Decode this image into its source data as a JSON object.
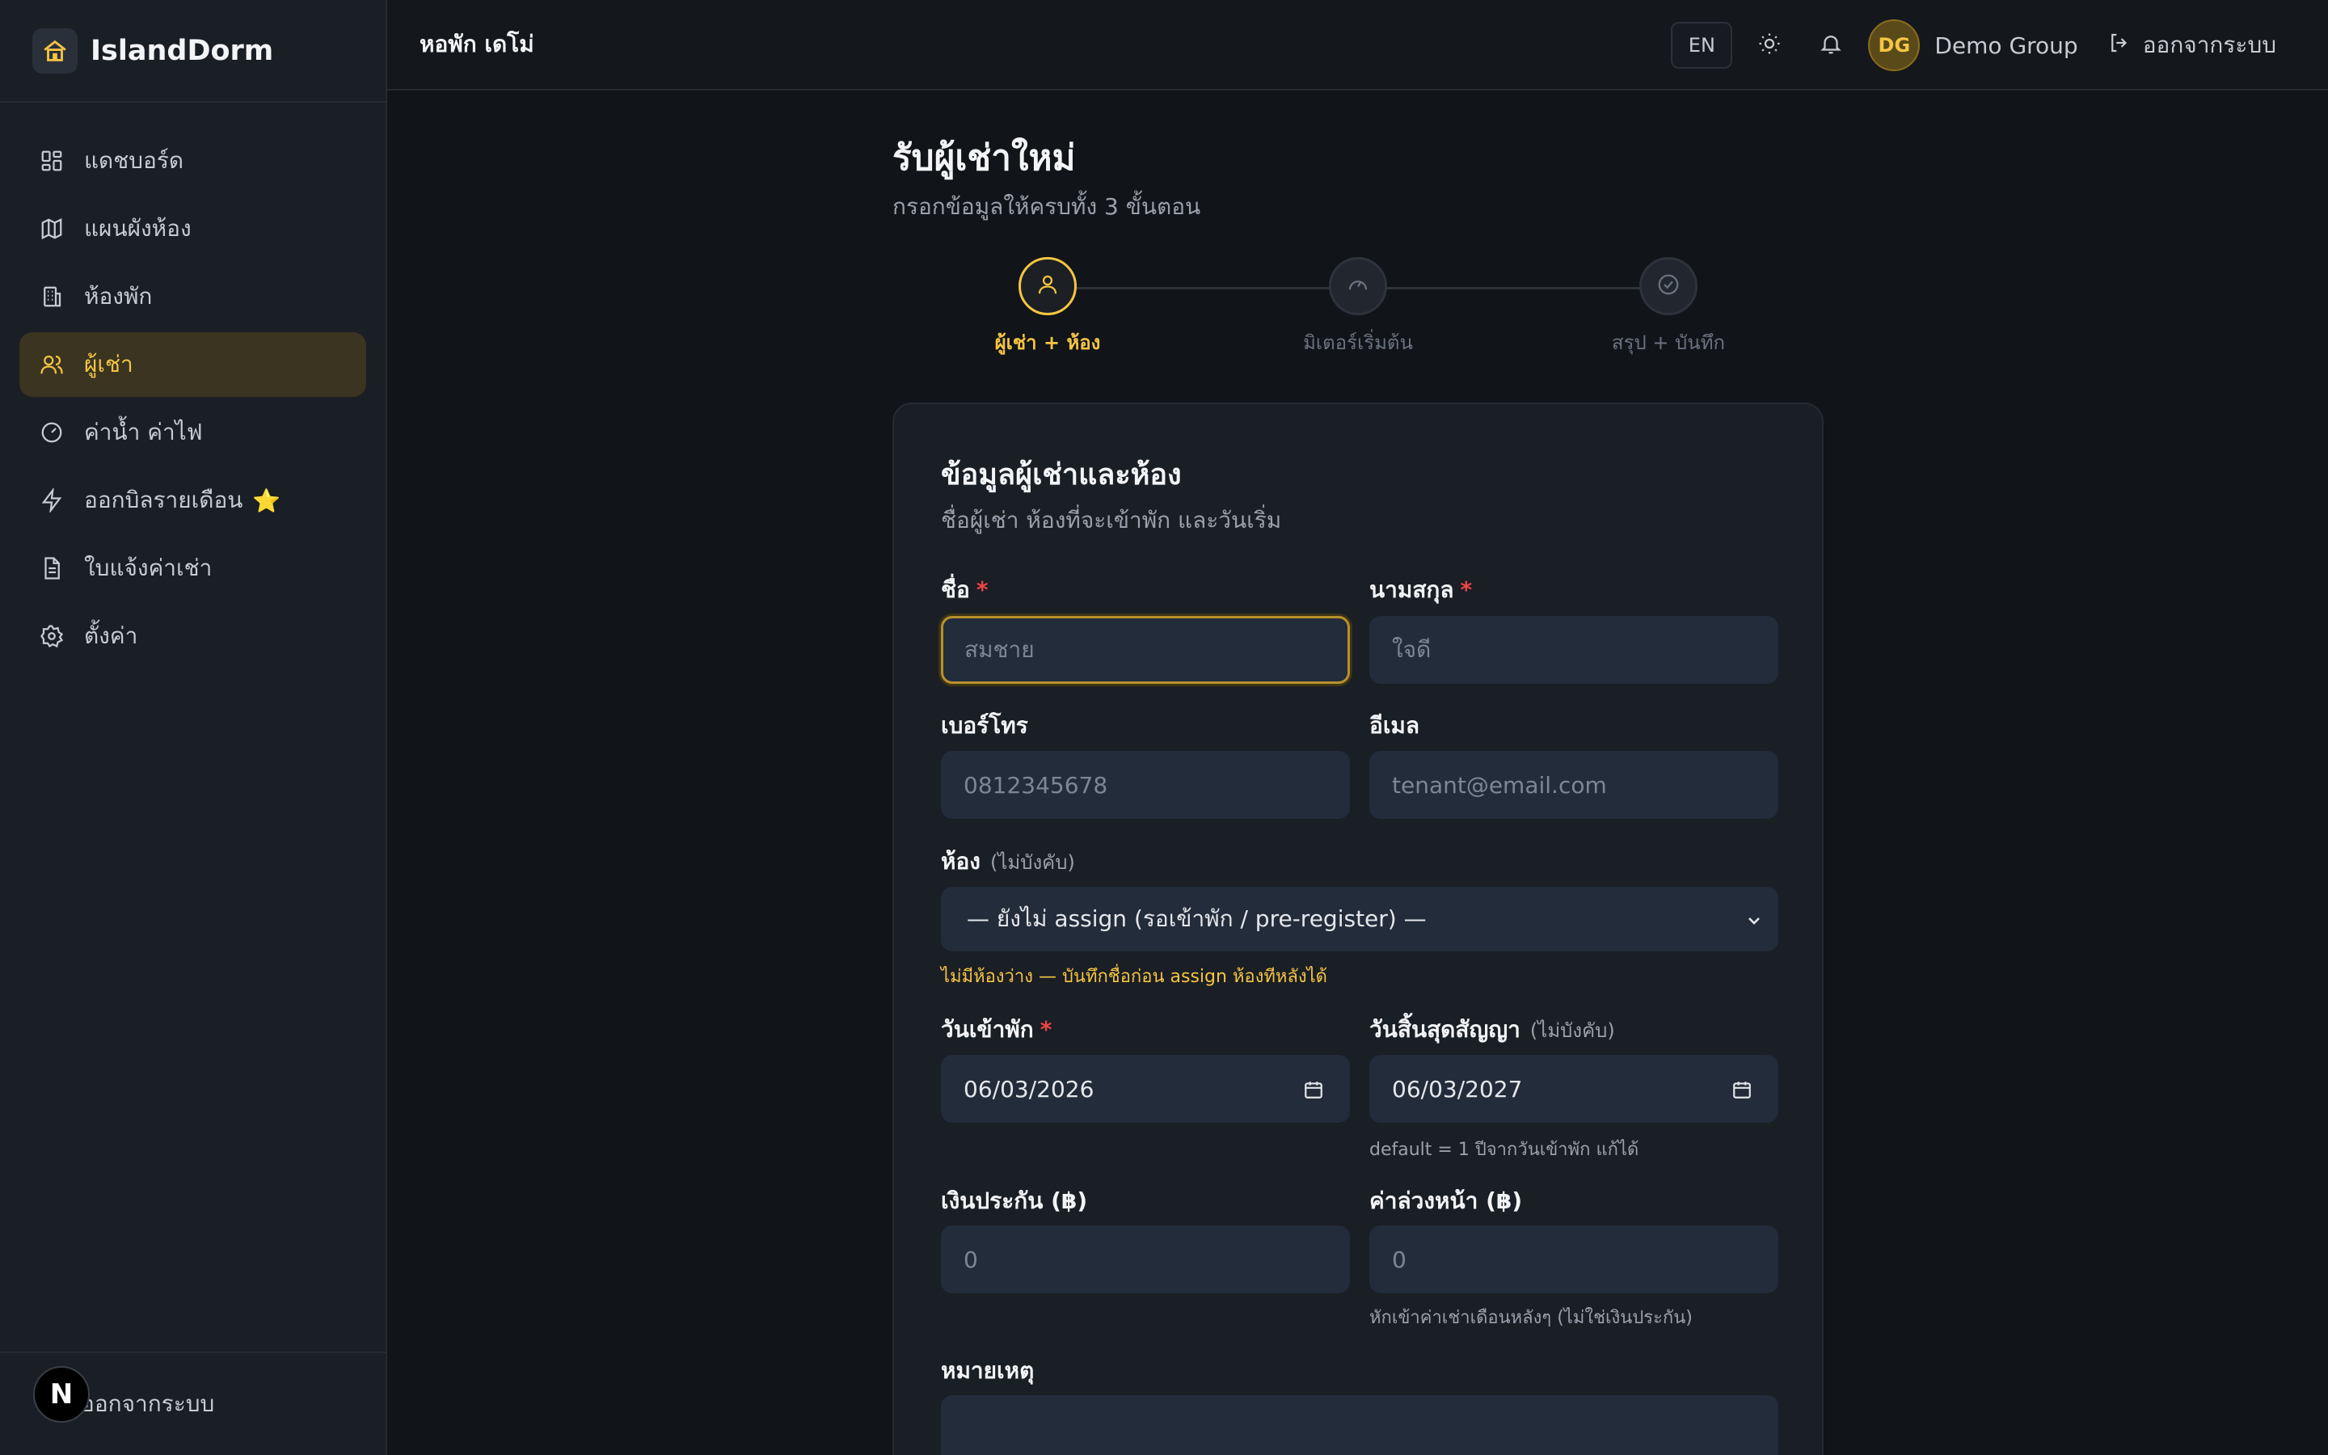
{
  "app": {
    "name": "IslandDorm"
  },
  "sidebar": {
    "items": [
      {
        "label": "แดชบอร์ด",
        "icon": "dashboard-icon"
      },
      {
        "label": "แผนผังห้อง",
        "icon": "map-icon"
      },
      {
        "label": "ห้องพัก",
        "icon": "building-icon"
      },
      {
        "label": "ผู้เช่า",
        "icon": "users-icon",
        "active": true
      },
      {
        "label": "ค่าน้ำ ค่าไฟ",
        "icon": "gauge-icon"
      },
      {
        "label": "ออกบิลรายเดือน",
        "icon": "lightning-icon",
        "badge": "⭐"
      },
      {
        "label": "ใบแจ้งค่าเช่า",
        "icon": "document-icon"
      },
      {
        "label": "ตั้งค่า",
        "icon": "gear-icon"
      }
    ],
    "footer_logout": "ออกจากระบบ",
    "next_badge": "N"
  },
  "topbar": {
    "dorm_name": "หอพัก เดโม่",
    "lang": "EN",
    "avatar_initials": "DG",
    "user_name": "Demo Group",
    "logout": "ออกจากระบบ"
  },
  "page": {
    "title": "รับผู้เช่าใหม่",
    "subtitle": "กรอกข้อมูลให้ครบทั้ง 3 ขั้นตอน"
  },
  "stepper": {
    "steps": [
      {
        "label": "ผู้เช่า + ห้อง",
        "icon": "user-icon",
        "active": true
      },
      {
        "label": "มิเตอร์เริ่มต้น",
        "icon": "gauge-icon",
        "active": false
      },
      {
        "label": "สรุป + บันทึก",
        "icon": "check-circle-icon",
        "active": false
      }
    ]
  },
  "form": {
    "title": "ข้อมูลผู้เช่าและห้อง",
    "subtitle": "ชื่อผู้เช่า ห้องที่จะเข้าพัก และวันเริ่ม",
    "first_name": {
      "label": "ชื่อ",
      "required": "*",
      "placeholder": "สมชาย"
    },
    "last_name": {
      "label": "นามสกุล",
      "required": "*",
      "placeholder": "ใจดี"
    },
    "phone": {
      "label": "เบอร์โทร",
      "placeholder": "0812345678"
    },
    "email": {
      "label": "อีเมล",
      "placeholder": "tenant@email.com"
    },
    "room": {
      "label": "ห้อง",
      "optional": "(ไม่บังคับ)",
      "selected": "— ยังไม่ assign (รอเข้าพัก / pre-register) —",
      "hint": "ไม่มีห้องว่าง — บันทึกชื่อก่อน assign ห้องทีหลังได้"
    },
    "move_in": {
      "label": "วันเข้าพัก",
      "required": "*",
      "value": "06/03/2026"
    },
    "contract_end": {
      "label": "วันสิ้นสุดสัญญา",
      "optional": "(ไม่บังคับ)",
      "value": "06/03/2027",
      "hint": "default = 1 ปีจากวันเข้าพัก แก้ได้"
    },
    "deposit": {
      "label": "เงินประกัน (฿)",
      "placeholder": "0"
    },
    "advance": {
      "label": "ค่าล่วงหน้า (฿)",
      "placeholder": "0",
      "hint": "หักเข้าค่าเช่าเดือนหลังๆ (ไม่ใช่เงินประกัน)"
    },
    "notes": {
      "label": "หมายเหตุ"
    }
  },
  "colors": {
    "accent": "#f5c542",
    "background": "#111418",
    "sidebar": "#1a1e25",
    "input": "#222c3b",
    "required": "#ef4444"
  }
}
